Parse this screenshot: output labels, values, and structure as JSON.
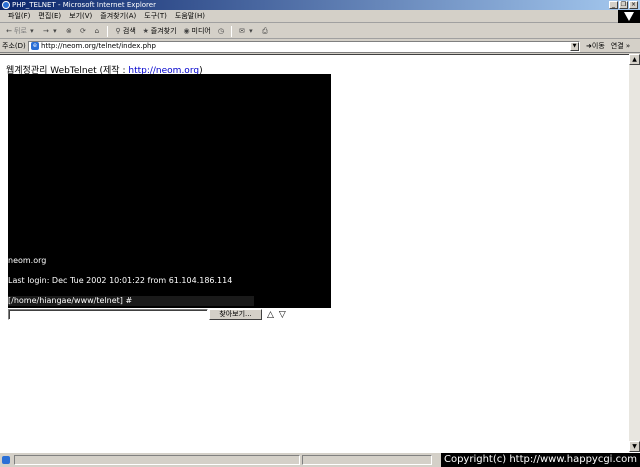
{
  "window": {
    "title": "PHP_TELNET - Microsoft Internet Explorer",
    "buttons": [
      "_",
      "❐",
      "×"
    ]
  },
  "menu": [
    "파일(F)",
    "편집(E)",
    "보기(V)",
    "즐겨찾기(A)",
    "도구(T)",
    "도움말(H)"
  ],
  "toolbar": {
    "back": "뒤로",
    "search": "검색",
    "favorites": "즐겨찾기",
    "media": "미디어"
  },
  "address": {
    "label": "주소(D)",
    "url": "http://neom.org/telnet/index.php",
    "go": "이동",
    "links": "연결 »"
  },
  "page": {
    "heading_prefix": "웹계정관리 WebTelnet (제작 : ",
    "heading_link": "http://neom.org",
    "heading_suffix": ")",
    "terminal": {
      "host": "neom.org",
      "last_login": "Last login: Dec Tue 2002 10:01:22 from 61.104.186.114",
      "prompt": "[/home/hiangae/www/telnet] #"
    },
    "browse_button": "찾아보기...",
    "up_arrow": "△",
    "down_arrow": "▽"
  },
  "footer": {
    "copyright": "Copyright(c) http://www.happycgi.com"
  }
}
